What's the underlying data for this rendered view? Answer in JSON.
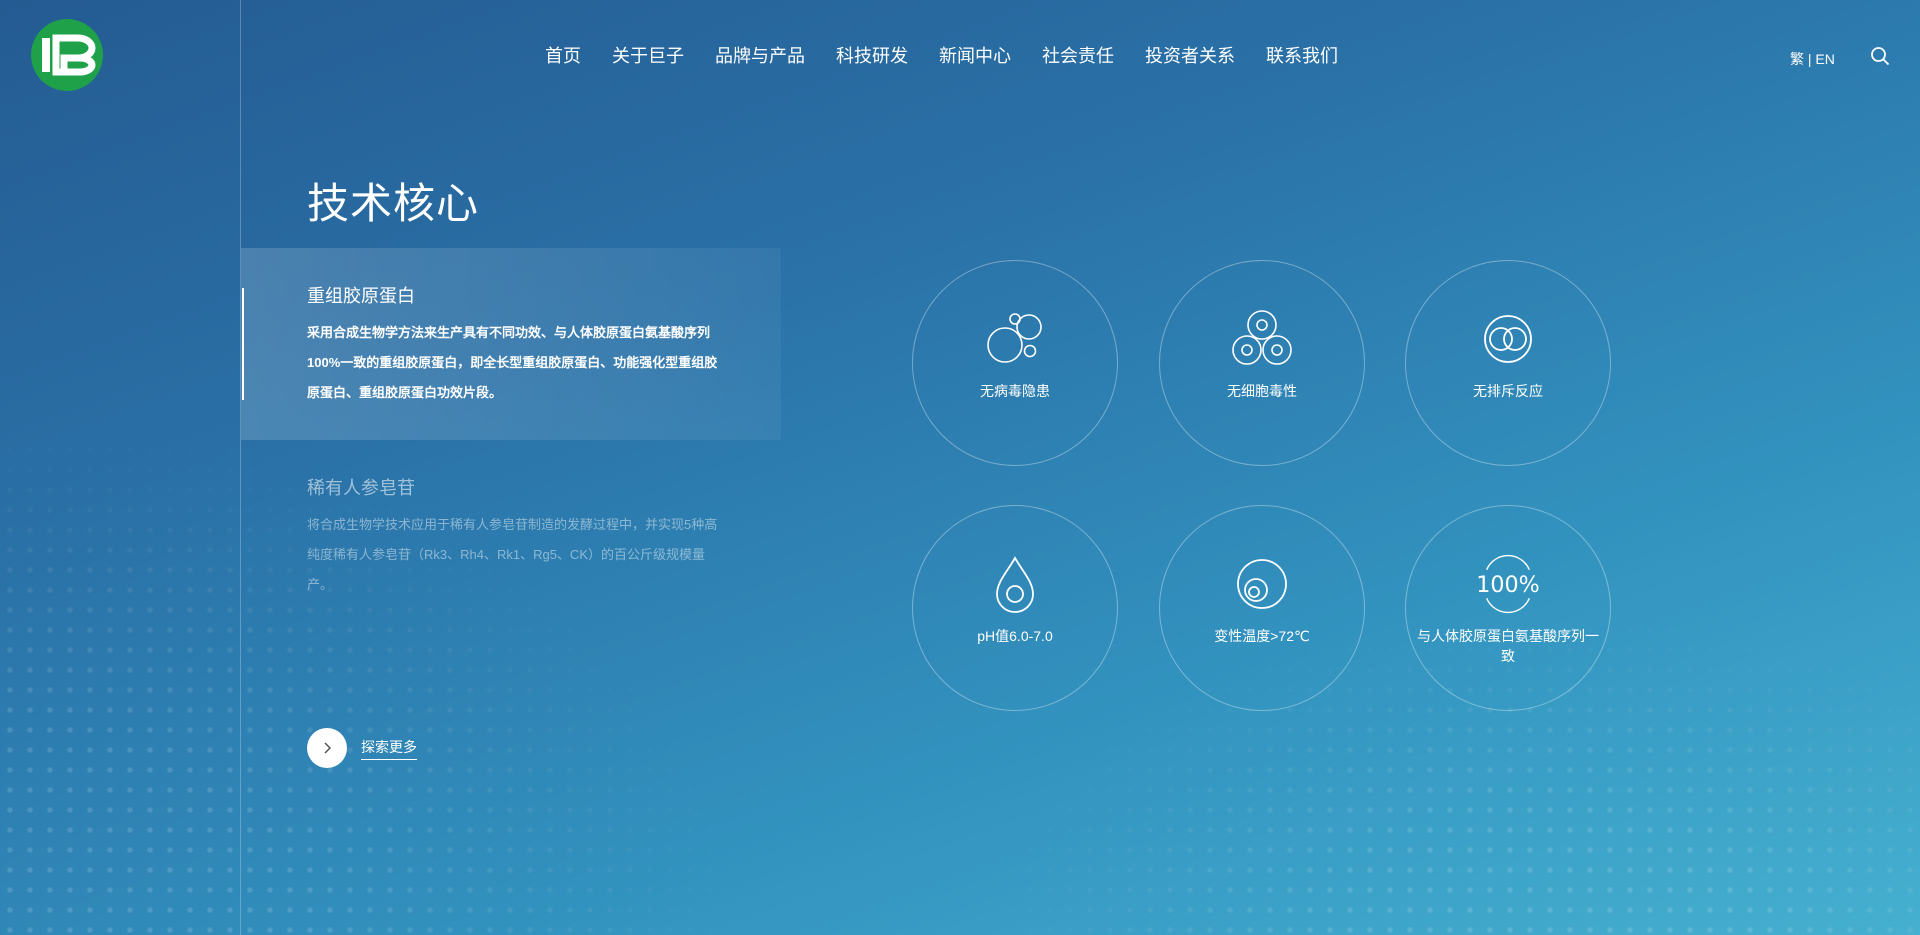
{
  "nav": {
    "items": [
      "首页",
      "关于巨子",
      "品牌与产品",
      "科技研发",
      "新闻中心",
      "社会责任",
      "投资者关系",
      "联系我们"
    ]
  },
  "lang": {
    "traditional": "繁",
    "separator": "|",
    "english": "EN"
  },
  "page": {
    "title": "技术核心"
  },
  "tech_items": [
    {
      "title": "重组胶原蛋白",
      "desc": "采用合成生物学方法来生产具有不同功效、与人体胶原蛋白氨基酸序列100%一致的重组胶原蛋白，即全长型重组胶原蛋白、功能强化型重组胶原蛋白、重组胶原蛋白功效片段。"
    },
    {
      "title": "稀有人参皂苷",
      "desc": "将合成生物学技术应用于稀有人参皂苷制造的发酵过程中，并实现5种高纯度稀有人参皂苷（Rk3、Rh4、Rk1、Rg5、CK）的百公斤级规模量产。"
    }
  ],
  "more": {
    "label": "探索更多"
  },
  "features": [
    {
      "label": "无病毒隐患",
      "icon": "bubbles-icon"
    },
    {
      "label": "无细胞毒性",
      "icon": "cells-icon"
    },
    {
      "label": "无排斥反应",
      "icon": "rings-icon"
    },
    {
      "label": "pH值6.0-7.0",
      "icon": "droplet-icon"
    },
    {
      "label": "变性温度>72℃",
      "icon": "temperature-icon"
    },
    {
      "label": "与人体胶原蛋白氨基酸序列一致",
      "icon": "percent-icon",
      "badge": "100%"
    }
  ],
  "colors": {
    "logo_green": "#1fa14a",
    "bg_top": "#245b92",
    "bg_bottom": "#46b0d0"
  }
}
